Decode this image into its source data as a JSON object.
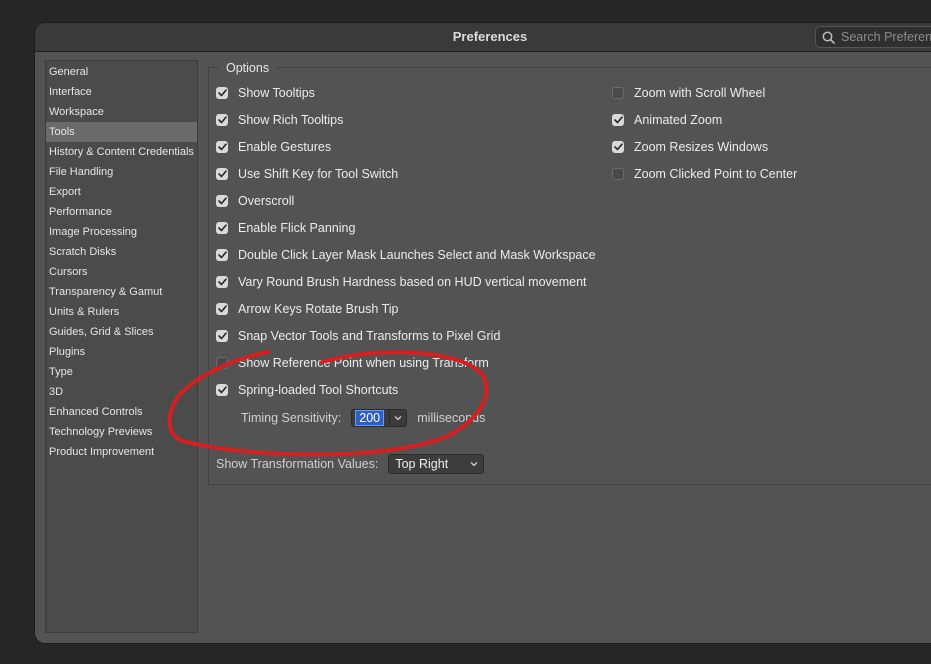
{
  "window": {
    "title": "Preferences"
  },
  "search": {
    "placeholder": "Search Preferences"
  },
  "sidebar": {
    "items": [
      {
        "label": "General"
      },
      {
        "label": "Interface"
      },
      {
        "label": "Workspace"
      },
      {
        "label": "Tools",
        "selected": true
      },
      {
        "label": "History & Content Credentials"
      },
      {
        "label": "File Handling"
      },
      {
        "label": "Export"
      },
      {
        "label": "Performance"
      },
      {
        "label": "Image Processing"
      },
      {
        "label": "Scratch Disks"
      },
      {
        "label": "Cursors"
      },
      {
        "label": "Transparency & Gamut"
      },
      {
        "label": "Units & Rulers"
      },
      {
        "label": "Guides, Grid & Slices"
      },
      {
        "label": "Plugins"
      },
      {
        "label": "Type"
      },
      {
        "label": "3D"
      },
      {
        "label": "Enhanced Controls"
      },
      {
        "label": "Technology Previews"
      },
      {
        "label": "Product Improvement"
      }
    ]
  },
  "options": {
    "legend": "Options",
    "left": [
      {
        "label": "Show Tooltips",
        "checked": true
      },
      {
        "label": "Show Rich Tooltips",
        "checked": true
      },
      {
        "label": "Enable Gestures",
        "checked": true
      },
      {
        "label": "Use Shift Key for Tool Switch",
        "checked": true
      },
      {
        "label": "Overscroll",
        "checked": true
      },
      {
        "label": "Enable Flick Panning",
        "checked": true
      },
      {
        "label": "Double Click Layer Mask Launches Select and Mask Workspace",
        "checked": true
      },
      {
        "label": "Vary Round Brush Hardness based on HUD vertical movement",
        "checked": true
      },
      {
        "label": "Arrow Keys Rotate Brush Tip",
        "checked": true
      },
      {
        "label": "Snap Vector Tools and Transforms to Pixel Grid",
        "checked": true
      },
      {
        "label": "Show Reference Point when using Transform",
        "checked": false
      },
      {
        "label": "Spring-loaded Tool Shortcuts",
        "checked": true
      }
    ],
    "right": [
      {
        "label": "Zoom with Scroll Wheel",
        "checked": false
      },
      {
        "label": "Animated Zoom",
        "checked": true
      },
      {
        "label": "Zoom Resizes Windows",
        "checked": true
      },
      {
        "label": "Zoom Clicked Point to Center",
        "checked": false
      }
    ],
    "timing": {
      "label": "Timing Sensitivity:",
      "value": "200",
      "unit": "milliseconds"
    },
    "transform_values": {
      "label": "Show Transformation Values:",
      "selected": "Top Right"
    }
  },
  "annotation": {
    "color": "#d42020",
    "icon": "red-circle-annotation"
  }
}
